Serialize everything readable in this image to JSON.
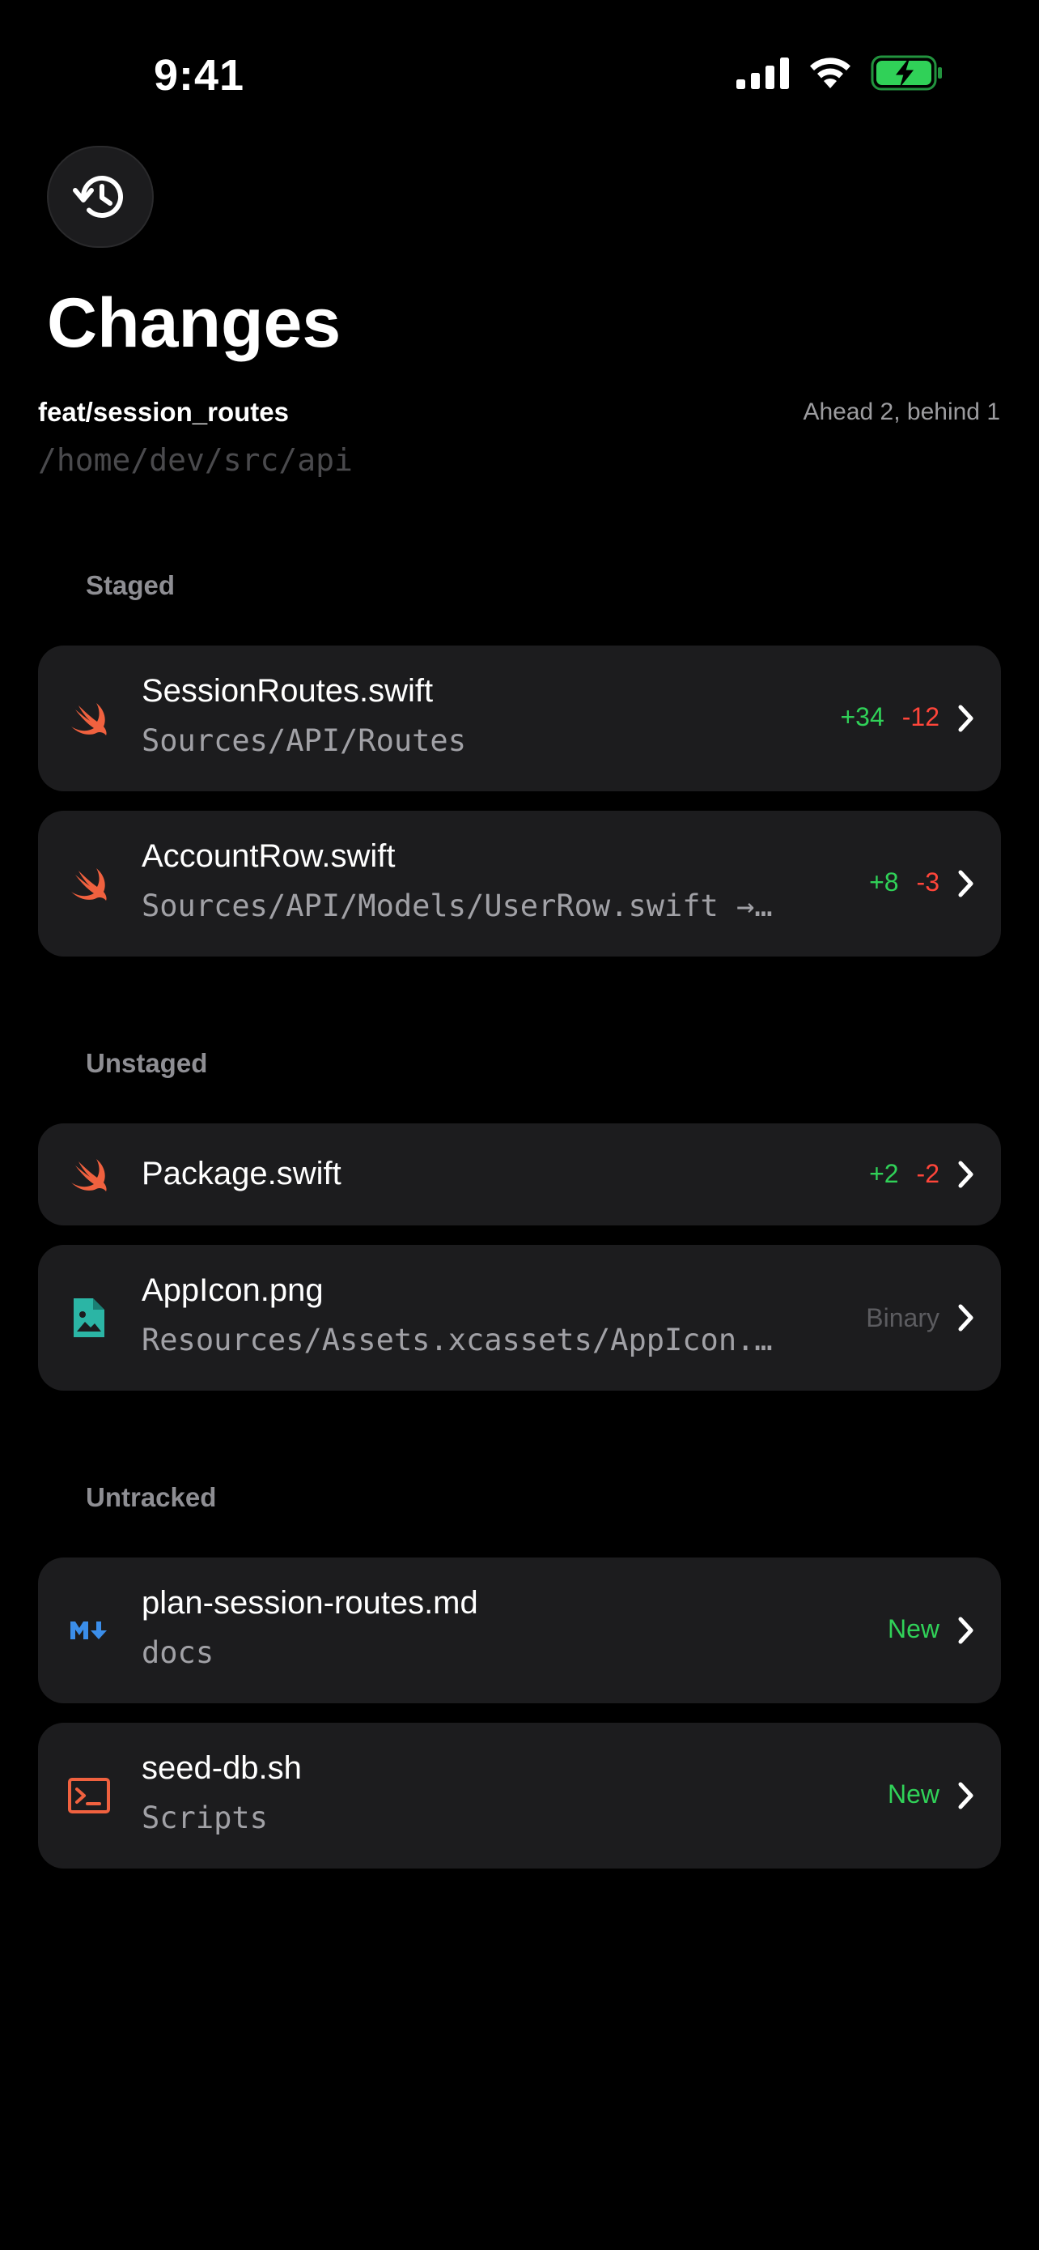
{
  "status_bar": {
    "time": "9:41"
  },
  "header": {
    "title": "Changes",
    "branch": "feat/session_routes",
    "ahead_behind": "Ahead 2, behind 1",
    "path": "/home/dev/src/api"
  },
  "sections": {
    "staged": {
      "title": "Staged",
      "items": [
        {
          "name": "SessionRoutes.swift",
          "path": "Sources/API/Routes",
          "additions": "+34",
          "deletions": "-12",
          "icon": "swift-icon"
        },
        {
          "name": "AccountRow.swift",
          "path": "Sources/API/Models/UserRow.swift →…",
          "additions": "+8",
          "deletions": "-3",
          "icon": "swift-icon"
        }
      ]
    },
    "unstaged": {
      "title": "Unstaged",
      "items": [
        {
          "name": "Package.swift",
          "additions": "+2",
          "deletions": "-2",
          "icon": "swift-icon"
        },
        {
          "name": "AppIcon.png",
          "path": "Resources/Assets.xcassets/AppIcon.…",
          "status": "Binary",
          "icon": "image-file-icon"
        }
      ]
    },
    "untracked": {
      "title": "Untracked",
      "items": [
        {
          "name": "plan-session-routes.md",
          "path": "docs",
          "status": "New",
          "icon": "markdown-icon"
        },
        {
          "name": "seed-db.sh",
          "path": "Scripts",
          "status": "New",
          "icon": "terminal-icon"
        }
      ]
    }
  },
  "colors": {
    "background": "#000000",
    "card": "#1c1c1e",
    "additions": "#30d158",
    "deletions": "#ff453a",
    "swift": "#f0613f",
    "image_icon": "#2bb5a5",
    "markdown_icon": "#3b8eea",
    "terminal_icon": "#f0613f",
    "battery": "#30d158"
  }
}
